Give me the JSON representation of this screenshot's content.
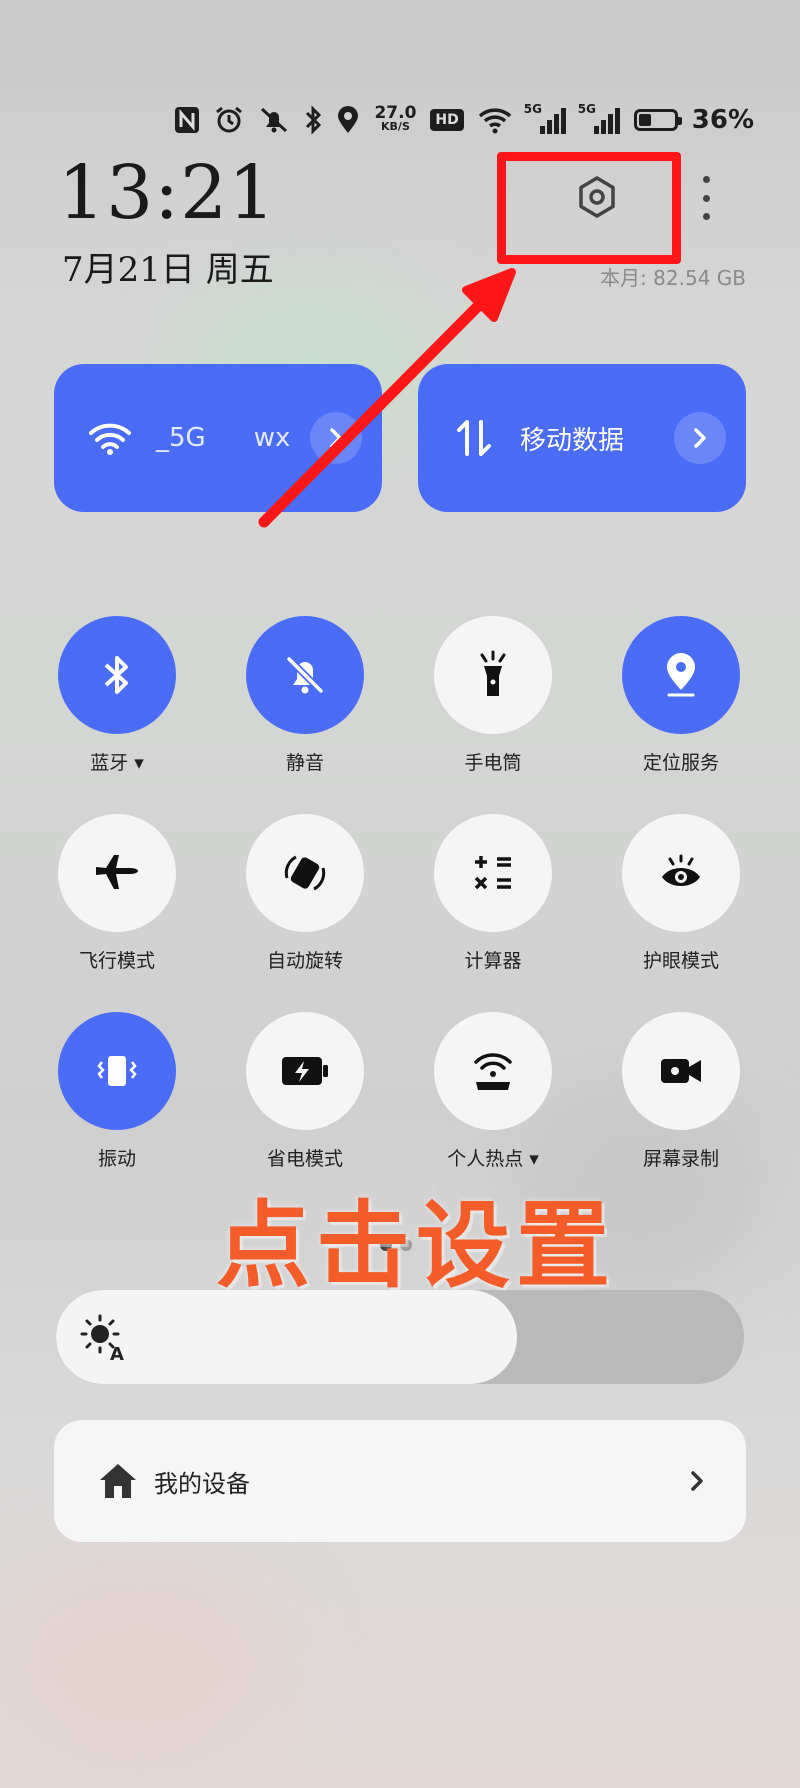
{
  "status_bar": {
    "netspeed_value": "27.0",
    "netspeed_unit": "KB/S",
    "hd_badge": "HD",
    "sim1_label": "5G",
    "sim2_label": "5G",
    "battery_percent": "36%",
    "battery_level": 0.36,
    "icons": [
      "nfc-icon",
      "alarm-icon",
      "mute-icon",
      "bluetooth-icon",
      "location-icon",
      "wifi-icon"
    ]
  },
  "header": {
    "time": "13:21",
    "date": "7月21日 周五",
    "storage": "本月: 82.54 GB"
  },
  "wifi_tile": {
    "label_left": "_5G",
    "label_right": "wx"
  },
  "data_tile": {
    "label": "移动数据"
  },
  "toggles": [
    {
      "label": "蓝牙 ▾",
      "icon": "bluetooth-icon",
      "state": "on"
    },
    {
      "label": "静音",
      "icon": "bell-off-icon",
      "state": "on"
    },
    {
      "label": "手电筒",
      "icon": "flashlight-icon",
      "state": "off"
    },
    {
      "label": "定位服务",
      "icon": "location-pin-icon",
      "state": "on"
    },
    {
      "label": "飞行模式",
      "icon": "airplane-icon",
      "state": "off"
    },
    {
      "label": "自动旋转",
      "icon": "auto-rotate-icon",
      "state": "off"
    },
    {
      "label": "计算器",
      "icon": "calculator-icon",
      "state": "off"
    },
    {
      "label": "护眼模式",
      "icon": "eye-icon",
      "state": "off"
    },
    {
      "label": "振动",
      "icon": "vibrate-icon",
      "state": "on"
    },
    {
      "label": "省电模式",
      "icon": "battery-saver-icon",
      "state": "off"
    },
    {
      "label": "个人热点 ▾",
      "icon": "hotspot-icon",
      "state": "off"
    },
    {
      "label": "屏幕录制",
      "icon": "screen-record-icon",
      "state": "off"
    }
  ],
  "brightness": {
    "level": 0.67
  },
  "devices": {
    "label": "我的设备"
  },
  "annotation": {
    "text": "点击设置",
    "color": "#f45d2a",
    "box_color": "#ff1616"
  },
  "colors": {
    "accent": "#4a6cf7",
    "tile_off": "#f5f5f5"
  }
}
